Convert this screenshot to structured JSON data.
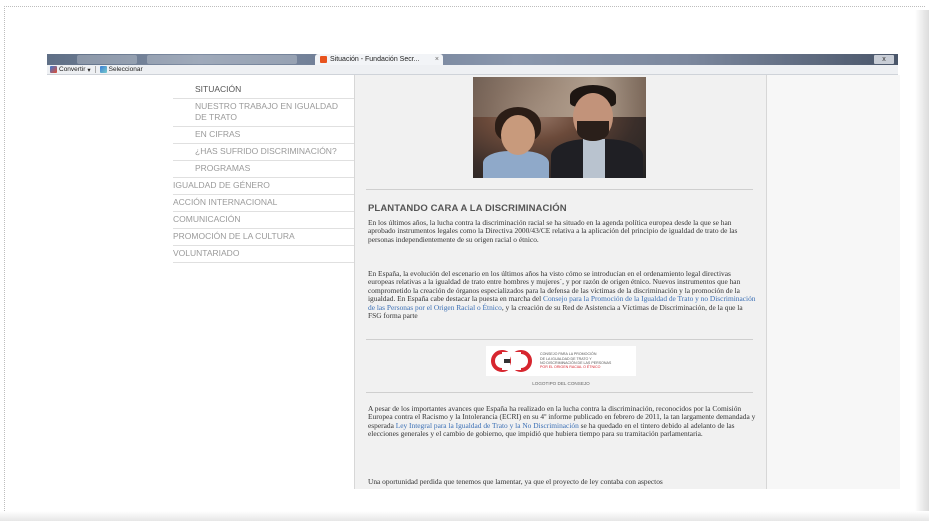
{
  "browser": {
    "tab_title": "Situación - Fundación Secr...",
    "tab_close": "×",
    "window_close": "x",
    "toolbar": {
      "convert_label": "Convertir",
      "convert_arrow": "▾",
      "select_label": "Seleccionar"
    }
  },
  "sidebar": {
    "items": [
      {
        "label": "SITUACIÓN",
        "level": "sub",
        "active": true
      },
      {
        "label": "NUESTRO TRABAJO EN IGUALDAD DE TRATO",
        "level": "sub",
        "active": false
      },
      {
        "label": "EN CIFRAS",
        "level": "sub",
        "active": false
      },
      {
        "label": "¿HAS SUFRIDO DISCRIMINACIÓN?",
        "level": "sub",
        "active": false
      },
      {
        "label": "PROGRAMAS",
        "level": "sub",
        "active": false
      },
      {
        "label": "IGUALDAD DE GÉNERO",
        "level": "top",
        "active": false
      },
      {
        "label": "ACCIÓN INTERNACIONAL",
        "level": "top",
        "active": false
      },
      {
        "label": "COMUNICACIÓN",
        "level": "top",
        "active": false
      },
      {
        "label": "PROMOCIÓN DE LA CULTURA",
        "level": "top",
        "active": false
      },
      {
        "label": "VOLUNTARIADO",
        "level": "top",
        "active": false
      }
    ]
  },
  "article": {
    "title": "PLANTANDO CARA A LA DISCRIMINACIÓN",
    "p1": "En los últimos años, la lucha contra la discriminación racial se ha situado en la agenda política europea desde la que se han aprobado instrumentos legales como la Directiva 2000/43/CE relativa a la aplicación del principio de igualdad de trato de las personas independientemente de su origen racial o étnico.",
    "p2_before": "En España, la evolución del escenario en los últimos años ha visto cómo se introducían en el ordenamiento legal directivas europeas relativas a la igualdad de trato entre hombres y mujeres`, y por razón de origen étnico. Nuevos instrumentos que han comprometido la creación de órganos especializados para la defensa de las víctimas de la discriminación y la promoción de la igualdad. En España cabe destacar la puesta en marcha del ",
    "p2_link": "Consejo para la Promoción de la Igualdad de Trato y no Discriminación de las Personas por el Origen Racial o Étnico",
    "p2_after": ", y la creación de su Red de Asistencia a Víctimas de Discriminación, de la que la FSG forma parte",
    "logo_lines": [
      "Consejo para la Promoción",
      "de la Igualdad de Trato y",
      "no Discriminación de las Personas"
    ],
    "logo_highlight": "por el Origen Racial o Étnico",
    "logo_caption": "LOGOTIPO DEL CONSEJO",
    "p3_before": "A pesar de los importantes avances que España ha realizado en la lucha contra la discriminación, reconocidos por la Comisión Europea contra el Racismo y la Intolerancia (ECRI) en su 4º informe publicado en febrero de 2011, la tan largamente demandada y esperada ",
    "p3_link": "Ley Integral para la Igualdad de Trato y la No Discriminación",
    "p3_after": " se ha quedado en el tintero debido al adelanto de las elecciones generales y el cambio de gobierno, que impidió que hubiera tiempo para su tramitación parlamentaria.",
    "p4": "Una oportunidad perdida que tenemos que lamentar, ya que el proyecto de ley contaba con aspectos"
  },
  "colors": {
    "link": "#3a6fb5",
    "logo_red": "#d7262f",
    "nav_text": "#9a9a9a",
    "content_bg": "#f1f1f1"
  }
}
